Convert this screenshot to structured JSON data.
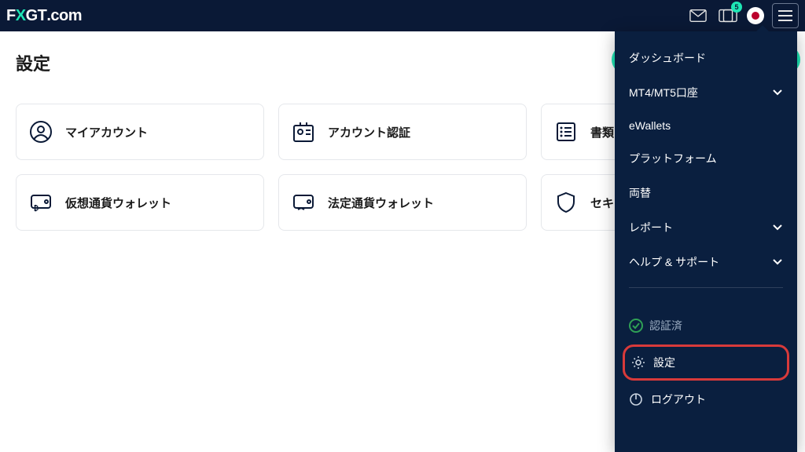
{
  "header": {
    "logo_prefix": "F",
    "logo_accent": "X",
    "logo_suffix": "GT",
    "logo_tail": ".com",
    "notification_count": "5",
    "locale": "ja"
  },
  "page": {
    "title": "設定"
  },
  "cards": [
    {
      "icon": "user",
      "label": "マイアカウント"
    },
    {
      "icon": "id",
      "label": "アカウント認証"
    },
    {
      "icon": "list",
      "label": "書類"
    },
    {
      "icon": "crypto-wallet",
      "label": "仮想通貨ウォレット"
    },
    {
      "icon": "fiat-wallet",
      "label": "法定通貨ウォレット"
    },
    {
      "icon": "shield",
      "label": "セキュリティ"
    }
  ],
  "dropdown": {
    "items": [
      {
        "label": "ダッシュボード",
        "chevron": false
      },
      {
        "label": "MT4/MT5口座",
        "chevron": true
      },
      {
        "label": "eWallets",
        "chevron": false
      },
      {
        "label": "プラットフォーム",
        "chevron": false
      },
      {
        "label": "両替",
        "chevron": false
      },
      {
        "label": "レポート",
        "chevron": true
      },
      {
        "label": "ヘルプ & サポート",
        "chevron": true
      }
    ],
    "status_label": "認証済",
    "settings_label": "設定",
    "logout_label": "ログアウト"
  }
}
